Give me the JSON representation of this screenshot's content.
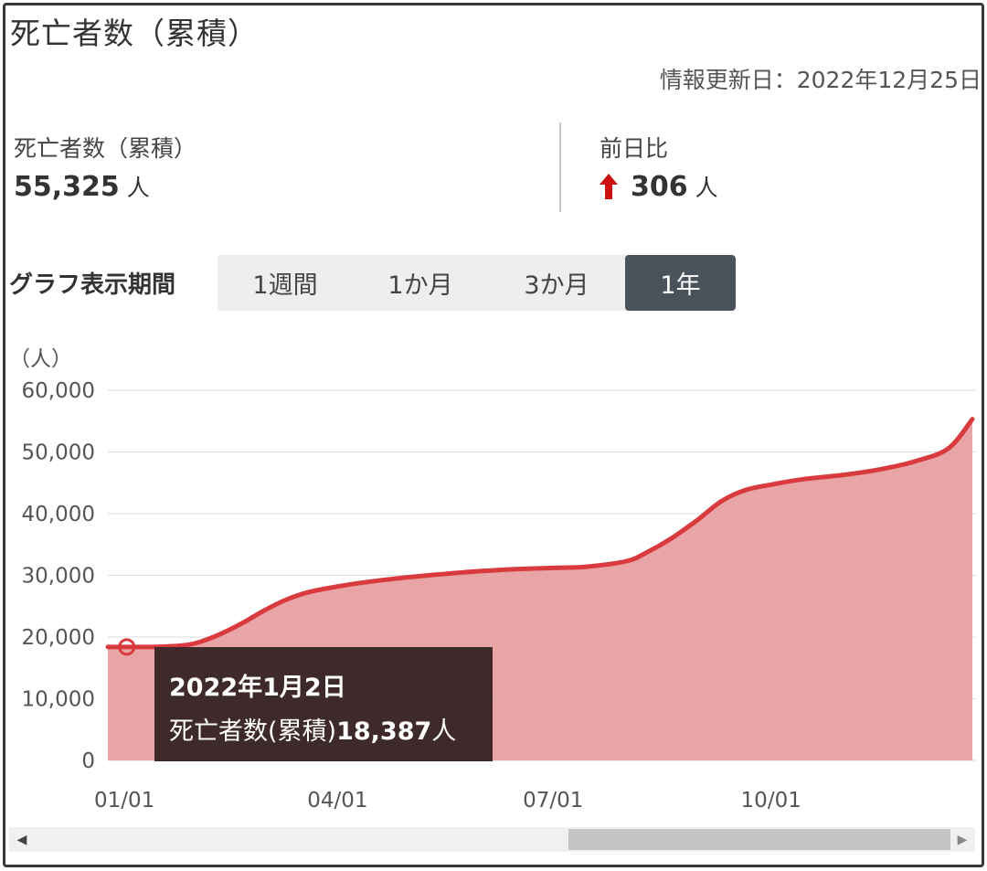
{
  "title": "死亡者数（累積）",
  "updated": "情報更新日：2022年12月25日",
  "stats": {
    "total_label": "死亡者数（累積）",
    "total_value": "55,325",
    "total_unit": "人",
    "diff_label": "前日比",
    "diff_value": "306",
    "diff_unit": "人"
  },
  "period": {
    "label": "グラフ表示期間",
    "tabs": [
      "1週間",
      "1か月",
      "3か月",
      "1年"
    ],
    "active_index": 3
  },
  "colors": {
    "line": "#d93a3e",
    "area": "#e8a0a0",
    "up_arrow": "#cc1111",
    "active_tab": "#4a525b",
    "tooltip_bg": "#3e2a2a"
  },
  "tooltip": {
    "date": "2022年1月2日",
    "label": "死亡者数(累積)",
    "value": "18,387",
    "unit": "人"
  },
  "chart_data": {
    "type": "area",
    "unit_label": "（人）",
    "x_ticks": [
      "01/01",
      "04/01",
      "07/01",
      "10/01"
    ],
    "x": [
      "2021-12-25",
      "2022-01-02",
      "2022-01-15",
      "2022-01-25",
      "2022-02-01",
      "2022-02-10",
      "2022-02-20",
      "2022-03-01",
      "2022-03-10",
      "2022-03-20",
      "2022-04-01",
      "2022-04-15",
      "2022-05-01",
      "2022-05-15",
      "2022-06-01",
      "2022-06-15",
      "2022-07-01",
      "2022-07-15",
      "2022-08-01",
      "2022-08-10",
      "2022-08-20",
      "2022-08-31",
      "2022-09-10",
      "2022-09-20",
      "2022-10-01",
      "2022-10-15",
      "2022-11-01",
      "2022-11-15",
      "2022-12-01",
      "2022-12-15",
      "2022-12-25"
    ],
    "series": [
      {
        "values": [
          18380,
          18387,
          18420,
          18600,
          19100,
          20400,
          22300,
          24300,
          26000,
          27300,
          28200,
          29000,
          29700,
          30200,
          30700,
          31000,
          31200,
          31400,
          32300,
          33800,
          36000,
          39000,
          42000,
          43800,
          44700,
          45600,
          46300,
          47100,
          48500,
          50600,
          55325
        ]
      }
    ],
    "ylim": [
      0,
      60000
    ],
    "y_ticks": [
      0,
      10000,
      20000,
      30000,
      40000,
      50000,
      60000
    ],
    "y_tick_labels": [
      "0",
      "10,000",
      "20,000",
      "30,000",
      "40,000",
      "50,000",
      "60,000"
    ],
    "highlight_index": 1,
    "grid": true
  }
}
